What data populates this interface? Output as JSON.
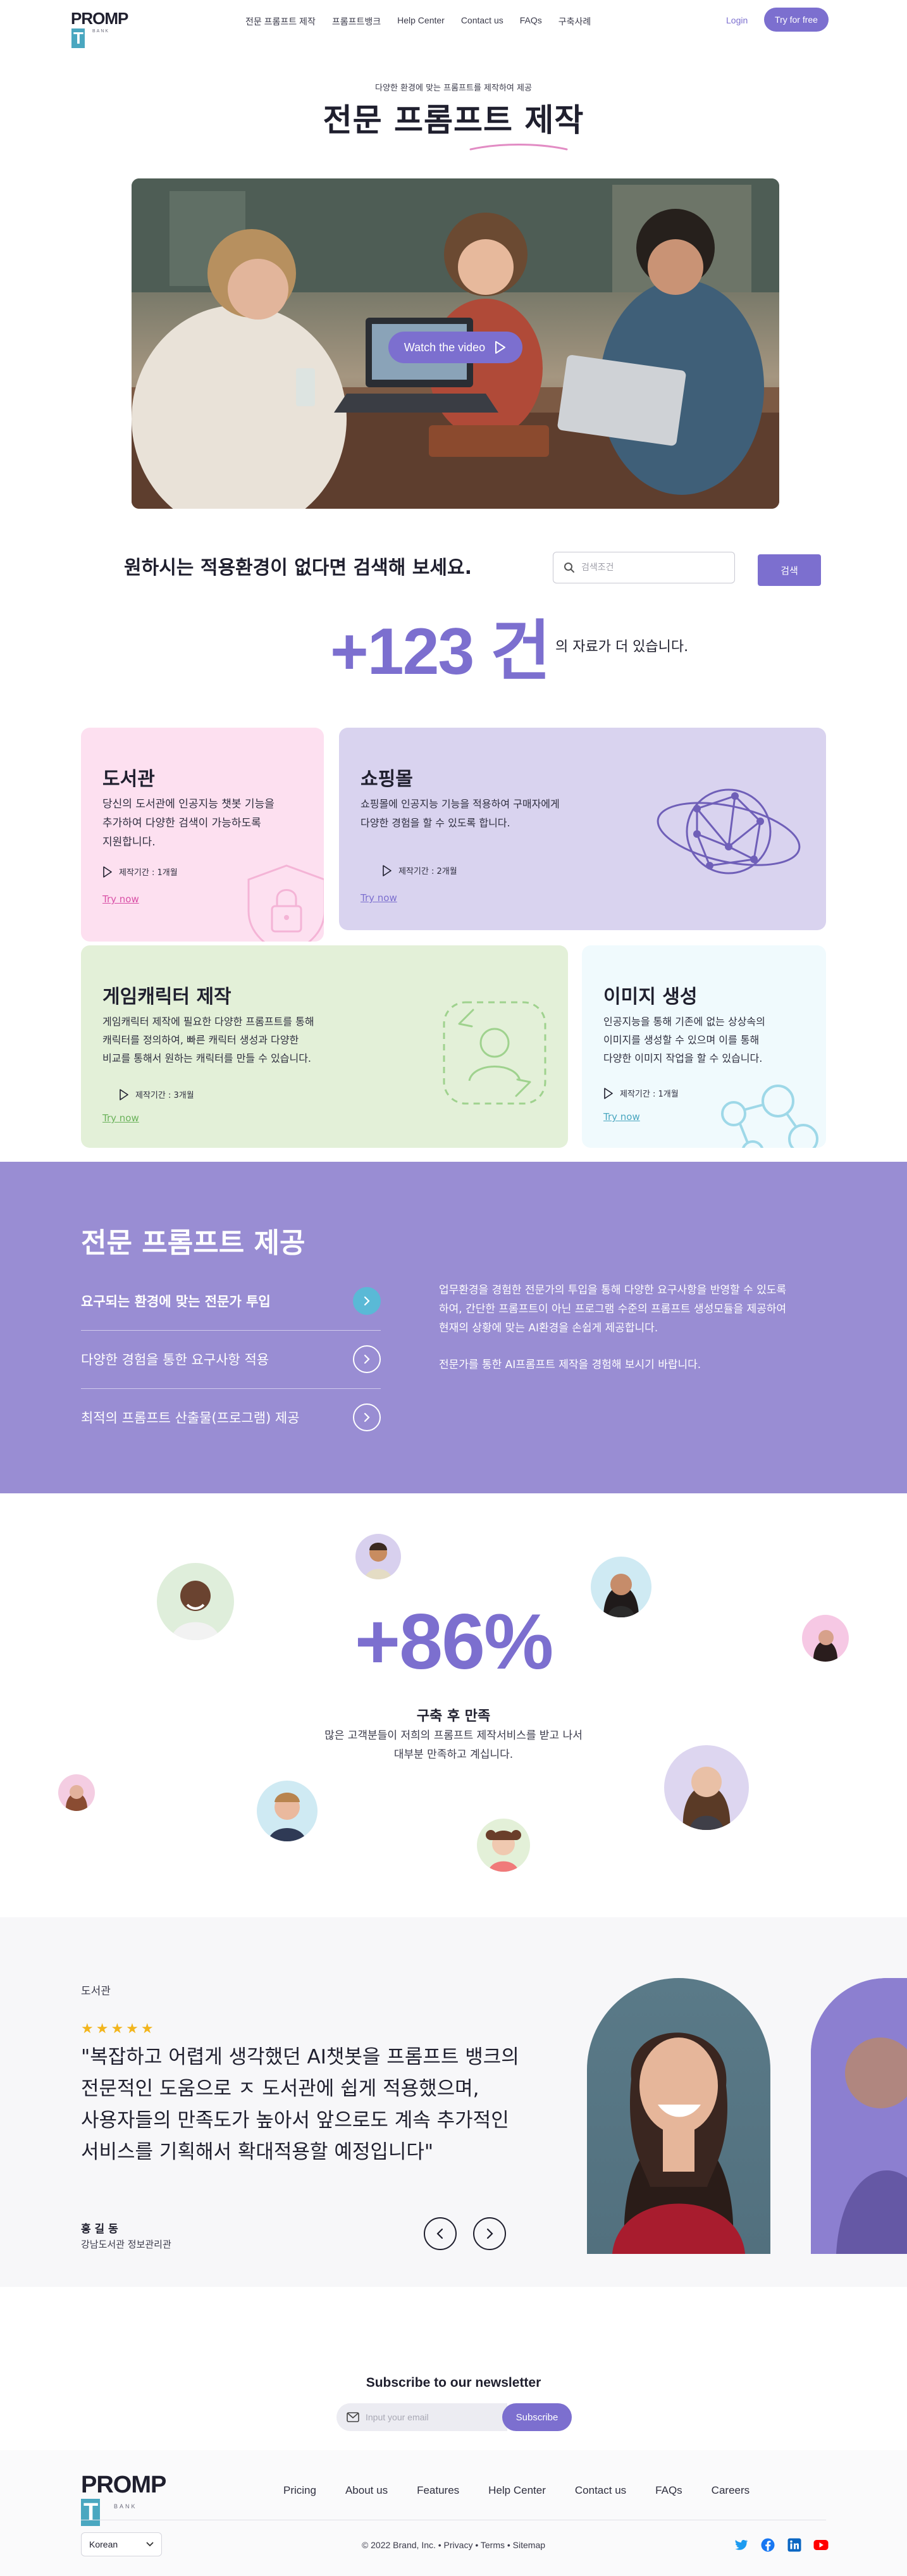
{
  "nav": {
    "logo_word": "PROMP",
    "logo_letter": "T",
    "logo_sub": "BANK",
    "links": [
      "전문 프롬프트 제작",
      "프롬프트뱅크",
      "Help Center",
      "Contact us",
      "FAQs",
      "구축사례"
    ],
    "login": "Login",
    "try_free": "Try for free"
  },
  "hero": {
    "kicker": "다양한 환경에 맞는 프롬프트를 제작하여 제공",
    "title": "전문 프롬프트 제작",
    "watch_label": "Watch the video"
  },
  "search": {
    "heading": "원하시는 적용환경이 없다면 검색해 보세요.",
    "placeholder": "검색조건",
    "button": "검색",
    "count": "+123 건",
    "count_tail": "의 자료가 더 있습니다."
  },
  "cards": [
    {
      "title": "도서관",
      "desc": [
        "당신의 도서관에 인공지능 챗봇 기능을",
        "추가하여 다양한 검색이 가능하도록",
        "지원합니다."
      ],
      "period": "제작기간 : 1개월",
      "try": "Try now",
      "bg": "#fde0f0",
      "link_color": "#d94fa6"
    },
    {
      "title": "쇼핑몰",
      "desc": [
        "쇼핑몰에 인공지능 기능을 적용하여 구매자에게",
        "다양한 경험을 할 수 있도록 합니다."
      ],
      "period": "제작기간 : 2개월",
      "try": "Try now",
      "bg": "#d9d3ef",
      "link_color": "#7c6fcf"
    },
    {
      "title": "게임캐릭터 제작",
      "desc": [
        "게임캐릭터 제작에 필요한 다양한 프롬프트를 통해",
        "캐릭터를 정의하여, 빠른 캐릭터 생성과 다양한",
        "비교를 통해서 원하는 캐릭터를 만들 수 있습니다."
      ],
      "period": "제작기간 : 3개월",
      "try": "Try now",
      "bg": "#e3f0d8",
      "link_color": "#6ab25a"
    },
    {
      "title": "이미지 생성",
      "desc": [
        "인공지능을 통해 기존에 없는 상상속의",
        "이미지를 생성할 수 있으며 이를 통해",
        "다양한 이미지 작업을 할 수 있습니다."
      ],
      "period": "제작기간 : 1개월",
      "try": "Try now",
      "bg": "#f0fafd",
      "link_color": "#4aa7c0"
    }
  ],
  "service": {
    "title": "전문 프롬프트 제공",
    "items": [
      "요구되는 환경에 맞는 전문가 투입",
      "다양한 경험을 통한 요구사항 적용",
      "최적의 프롬프트 산출물(프로그램) 제공"
    ],
    "text1": [
      "업무환경을 경험한 전문가의 투입을 통해 다양한 요구사항을  반영할 수 있도록",
      "하여, 간단한 프롬프트이 아닌 프로그램 수준의 프롬프트 생성모듈을 제공하여",
      "현재의 상황에 맞는 AI환경을 손쉽게 제공합니다."
    ],
    "text2": "전문가를 통한 AI프롬프트 제작을 경험해 보시기 바랍니다."
  },
  "stat": {
    "number": "+86%",
    "title": "구축 후 만족",
    "desc": [
      "많은 고객분들이 저희의 프롬프트 제작서비스를 받고 나서",
      "대부분 만족하고 계십니다."
    ],
    "progress_percent": 86
  },
  "testimonial": {
    "category": "도서관",
    "stars": "★★★★★",
    "quote": [
      "\"복잡하고 어렵게 생각했던 AI챗봇을 프롬프트 뱅크의",
      "전문적인 도움으로 ㅈ 도서관에 쉽게 적용했으며,",
      "사용자들의 만족도가 높아서 앞으로도 계속 추가적인",
      "서비스를 기획해서 확대적용할 예정입니다\""
    ],
    "name": "홍 길 동",
    "role": "강남도서관 정보관리관"
  },
  "newsletter": {
    "title": "Subscribe to our newsletter",
    "placeholder": "Input your email",
    "button": "Subscribe"
  },
  "footer": {
    "links": [
      "Pricing",
      "About us",
      "Features",
      "Help Center",
      "Contact us",
      "FAQs",
      "Careers"
    ],
    "language": "Korean",
    "copyright": "© 2022 Brand, Inc. • Privacy • Terms • Sitemap",
    "social_icons": [
      "twitter-icon",
      "facebook-icon",
      "linkedin-icon",
      "youtube-icon"
    ]
  },
  "colors": {
    "accent": "#7c6fcf",
    "service_bg": "#998dd3",
    "active_dot": "#5ab9d6"
  }
}
